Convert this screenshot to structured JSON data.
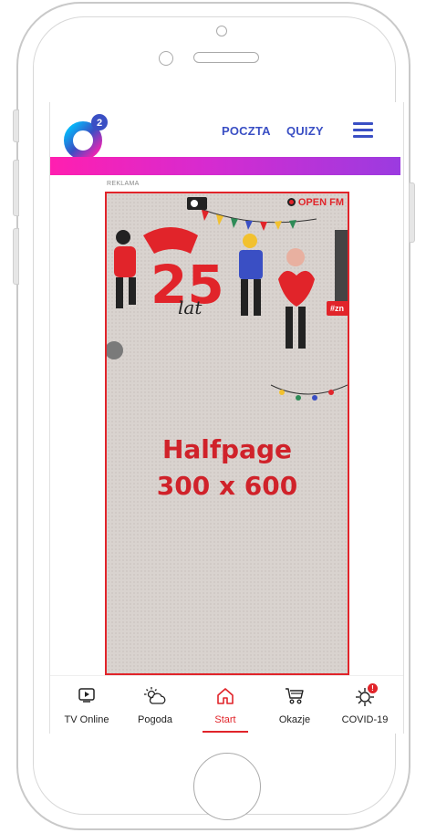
{
  "header": {
    "logo_text": "2",
    "nav": [
      {
        "label": "POCZTA"
      },
      {
        "label": "QUIZY"
      }
    ]
  },
  "ad": {
    "label": "REKLAMA",
    "brand": "OPEN FM",
    "hashtag": "#zn",
    "badge_text": "25",
    "badge_sub": "lat",
    "title_line1": "Halfpage",
    "title_line2": "300 x 600"
  },
  "bottom_nav": {
    "tabs": [
      {
        "label": "TV Online",
        "icon": "tv-play-icon"
      },
      {
        "label": "Pogoda",
        "icon": "weather-icon"
      },
      {
        "label": "Start",
        "icon": "home-icon",
        "active": true
      },
      {
        "label": "Okazje",
        "icon": "cart-icon"
      },
      {
        "label": "COVID-19",
        "icon": "virus-icon",
        "badge": "!"
      }
    ]
  },
  "colors": {
    "accent": "#e1242a",
    "nav_blue": "#3a4fc4",
    "gradient_start": "#ff1fb0",
    "gradient_end": "#9b3be0"
  }
}
